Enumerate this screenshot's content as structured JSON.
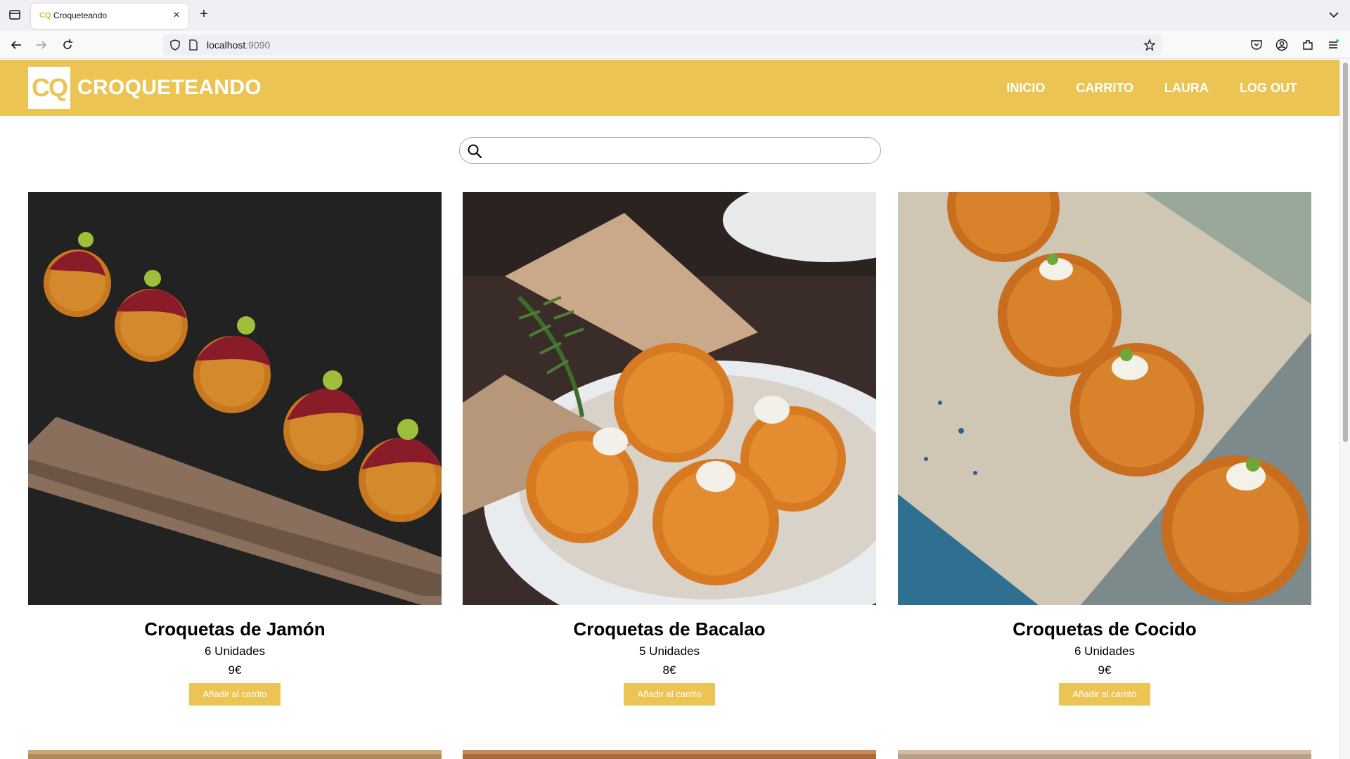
{
  "browser": {
    "tab_title": "Croqueteando",
    "favicon_text": "CQ",
    "url_host": "localhost",
    "url_port": ":9090"
  },
  "site": {
    "logo_text": "CQ",
    "brand": "CROQUETEANDO",
    "menu": [
      "INICIO",
      "CARRITO",
      "LAURA",
      "LOG OUT"
    ],
    "accent_color": "#ecc453"
  },
  "search": {
    "placeholder": "",
    "value": ""
  },
  "products": [
    {
      "name": "Croquetas de Jamón",
      "units": "6 Unidades",
      "price": "9€",
      "button": "Añadir al carrito"
    },
    {
      "name": "Croquetas de Bacalao",
      "units": "5 Unidades",
      "price": "8€",
      "button": "Añadir al carrito"
    },
    {
      "name": "Croquetas de Cocido",
      "units": "6 Unidades",
      "price": "9€",
      "button": "Añadir al carrito"
    }
  ]
}
